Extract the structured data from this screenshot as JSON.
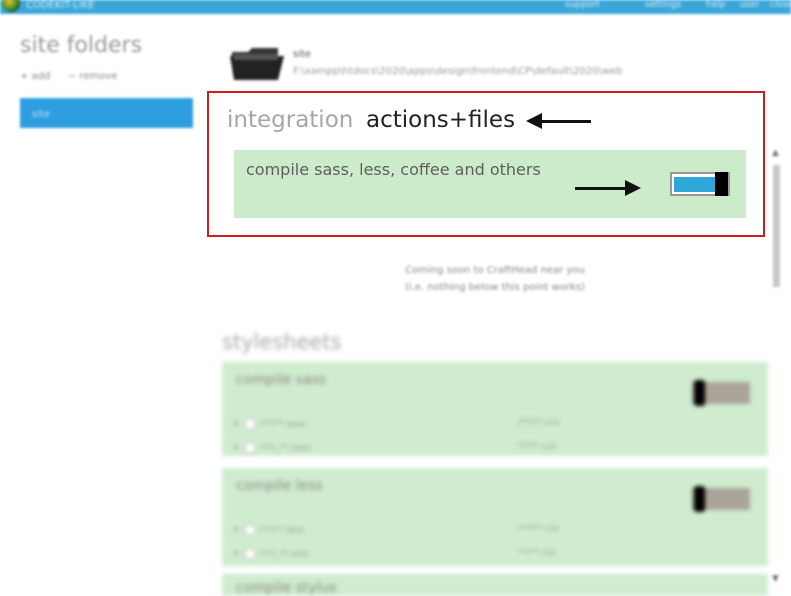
{
  "topbar": {
    "brand": "CODEKIT-LIKE",
    "items": [
      "support",
      "settings",
      "help",
      "user",
      "close"
    ]
  },
  "sidebar": {
    "title": "site folders",
    "add_label": "+ add",
    "remove_label": "− remove",
    "selected_item": "site"
  },
  "folder": {
    "name": "site",
    "path": "F:\\xampp\\htdocs\\2020\\apps\\design\\frontend\\CP\\default\\2020\\web"
  },
  "integration": {
    "label": "integration",
    "title": "actions+files",
    "option_label": "compile sass, less, coffee and others",
    "toggle_state": "on"
  },
  "notice": {
    "line1": "Coming soon to CraftHead near you",
    "line2": "(i.e. nothing below this point works)"
  },
  "stylesheets": {
    "title": "stylesheets",
    "cards": [
      {
        "label": "compile sass",
        "toggle_state": "off",
        "rows": [
          {
            "left": "/**/**.sass",
            "right": "/**/**.css"
          },
          {
            "left": "!**/_**.sass",
            "right": "**/**.css"
          }
        ]
      },
      {
        "label": "compile less",
        "toggle_state": "off",
        "rows": [
          {
            "left": "/**/**.less",
            "right": "/**/**.css"
          },
          {
            "left": "!**/_**.less",
            "right": "**/**.css"
          }
        ]
      },
      {
        "label": "compile stylus",
        "toggle_state": "off",
        "rows": []
      }
    ]
  },
  "colors": {
    "accent": "#2fa7d8",
    "card_green": "#cbebcb",
    "highlight": "#cc1f1f",
    "topbar": "#3aa6d8"
  }
}
